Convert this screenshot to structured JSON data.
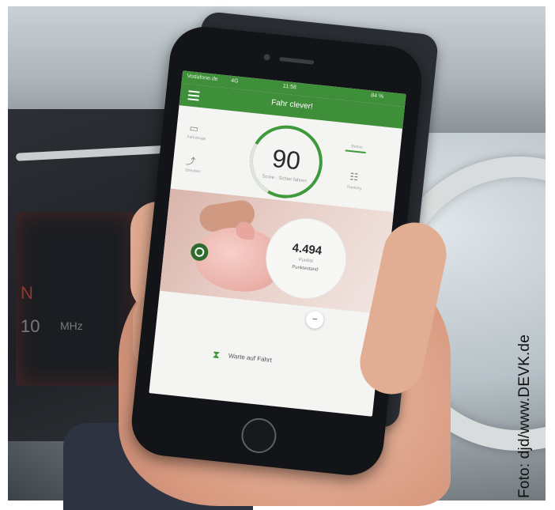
{
  "statusbar": {
    "carrier": "Vodafone.de",
    "network": "4G",
    "time": "11:58",
    "battery": "84 %"
  },
  "app": {
    "title": "Fahr clever!"
  },
  "score": {
    "value": "90",
    "sub_label": "Score",
    "sub_label2": "Sicher fahren"
  },
  "left_icons": {
    "top_caption": "Fahrzeuge",
    "bottom_caption": "Strecken"
  },
  "right_icons": {
    "top_caption": "Bonus",
    "bottom_caption": "Ranking"
  },
  "points": {
    "value": "4.494",
    "unit": "Punkte",
    "label": "Punktestand"
  },
  "footer": {
    "wait_text": "Warte auf Fahrt"
  },
  "credit": "Foto: djd/www.DEVK.de",
  "colors": {
    "accent_green": "#3e8e3a",
    "gauge_green": "#3e9a3a"
  },
  "dash_text": {
    "d1": "N",
    "d2": "10",
    "d3": "MHz"
  },
  "icons": {
    "menu": "hamburger-icon",
    "hourglass": "hourglass-icon",
    "minus": "minus-icon",
    "logo": "devk-logo-icon"
  }
}
